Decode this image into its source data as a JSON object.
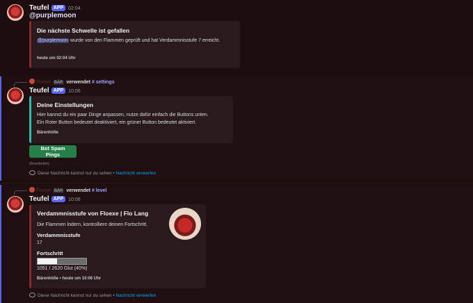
{
  "msg1": {
    "username": "Teufel",
    "badge": "APP",
    "time": "02:04",
    "mention": "@purplemoon",
    "embed": {
      "title": "Die nächste Schwelle ist gefallen",
      "mention": "@purplemoon",
      "text": " wurde von den Flammen geprüft und hat Verdammnisstufe 7 erreicht.",
      "footer": "heute um 02:04 Uhr"
    }
  },
  "msg2": {
    "reply": {
      "user": "Floexe",
      "tag": "BÄR",
      "verb": "verwendet",
      "command": "# settings"
    },
    "username": "Teufel",
    "badge": "APP",
    "time": "10:06",
    "embed": {
      "title": "Deine Einstellungen",
      "line1": "Hier kannst du ein paar Dinge anpassen, nutze dafür einfach die Buttons unten.",
      "line2": "Ein Roter Button bedeutet deaktiviert, ein grüner Button bedeutet aktiviert.",
      "footer": "Bärenhölle"
    },
    "button": "Bot Spam Pings",
    "edited": "(Bearbeitet)",
    "ephemeral": "Diese Nachricht kannst nur du sehen",
    "dismiss": "Nachricht verwerfen"
  },
  "msg3": {
    "reply": {
      "user": "Floexe",
      "tag": "BÄR",
      "verb": "verwendet",
      "command": "# level"
    },
    "username": "Teufel",
    "badge": "APP",
    "time": "10:06",
    "embed": {
      "title": "Verdammnisstufe von Floexe | Flo Lang",
      "desc": "Die Flammen lodern, kontrolliere deinen Fortschritt.",
      "field1_name": "Verdammnisstufe",
      "field1_value": "17",
      "field2_name": "Fortschritt",
      "progress": 0.4,
      "progress_text": "1051 / 2620 Glut (40%)",
      "footer": "Bärenhölle • heute um 10:06 Uhr"
    },
    "ephemeral": "Diese Nachricht kannst nur du sehen",
    "dismiss": "Nachricht verwerfen"
  },
  "separator": " • "
}
